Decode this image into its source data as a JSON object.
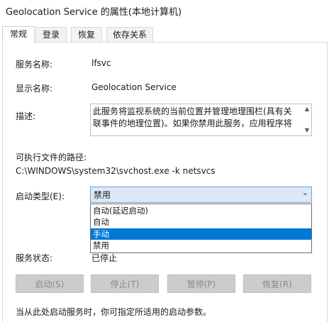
{
  "window": {
    "title": "Geolocation Service 的属性(本地计算机)"
  },
  "tabs": [
    {
      "label": "常规",
      "active": true
    },
    {
      "label": "登录",
      "active": false
    },
    {
      "label": "恢复",
      "active": false
    },
    {
      "label": "依存关系",
      "active": false
    }
  ],
  "general": {
    "service_name_label": "服务名称:",
    "service_name": "lfsvc",
    "display_name_label": "显示名称:",
    "display_name": "Geolocation Service",
    "description_label": "描述:",
    "description": "此服务将监视系统的当前位置并管理地理围栏(具有关联事件的地理位置)。如果你禁用此服务，应用程序将",
    "exe_path_label": "可执行文件的路径:",
    "exe_path": "C:\\WINDOWS\\system32\\svchost.exe -k netsvcs",
    "startup_type_label": "启动类型(E):",
    "startup_type_value": "禁用",
    "startup_options": [
      "自动(延迟启动)",
      "自动",
      "手动",
      "禁用"
    ],
    "startup_selected_index": 2,
    "service_status_label": "服务状态:",
    "service_status": "已停止",
    "buttons": {
      "start": "启动(S)",
      "stop": "停止(T)",
      "pause": "暂停(P)",
      "resume": "恢复(R)"
    },
    "hint": "当从此处启动服务时，你可指定所适用的启动参数。"
  },
  "colors": {
    "selection": "#0078d7",
    "combo_bg": "#dbe8f6",
    "disabled_button": "#cccccc"
  },
  "icons": {
    "combo_arrow": "chevron-down-icon",
    "scroll_up": "scroll-up-arrow-icon",
    "scroll_down": "scroll-down-arrow-icon"
  }
}
